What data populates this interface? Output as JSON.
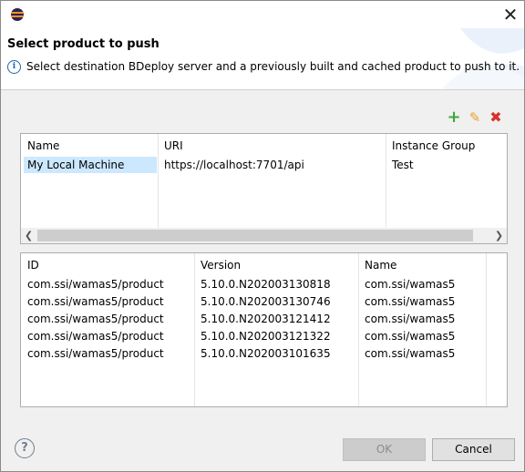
{
  "window": {
    "icon": "eclipse-icon",
    "close_label": "✕"
  },
  "banner": {
    "title": "Select product to push",
    "message": "Select destination BDeploy server and a previously built and cached product to push to it."
  },
  "toolbar": {
    "add_icon": "+",
    "edit_icon": "✎",
    "delete_icon": "✖"
  },
  "servers": {
    "headers": [
      "Name",
      "URI",
      "Instance Group"
    ],
    "rows": [
      {
        "name": "My Local Machine",
        "uri": "https://localhost:7701/api",
        "group": "Test",
        "selected": true
      }
    ]
  },
  "products": {
    "headers": [
      "ID",
      "Version",
      "Name"
    ],
    "rows": [
      {
        "id": "com.ssi/wamas5/product",
        "version": "5.10.0.N202003130818",
        "name": "com.ssi/wamas5"
      },
      {
        "id": "com.ssi/wamas5/product",
        "version": "5.10.0.N202003130746",
        "name": "com.ssi/wamas5"
      },
      {
        "id": "com.ssi/wamas5/product",
        "version": "5.10.0.N202003121412",
        "name": "com.ssi/wamas5"
      },
      {
        "id": "com.ssi/wamas5/product",
        "version": "5.10.0.N202003121322",
        "name": "com.ssi/wamas5"
      },
      {
        "id": "com.ssi/wamas5/product",
        "version": "5.10.0.N202003101635",
        "name": "com.ssi/wamas5"
      }
    ]
  },
  "buttons": {
    "ok": "OK",
    "cancel": "Cancel",
    "ok_enabled": false
  },
  "colors": {
    "selection": "#cce8ff",
    "add": "#3aa83a",
    "edit": "#e7a12b",
    "delete": "#d9302c"
  }
}
